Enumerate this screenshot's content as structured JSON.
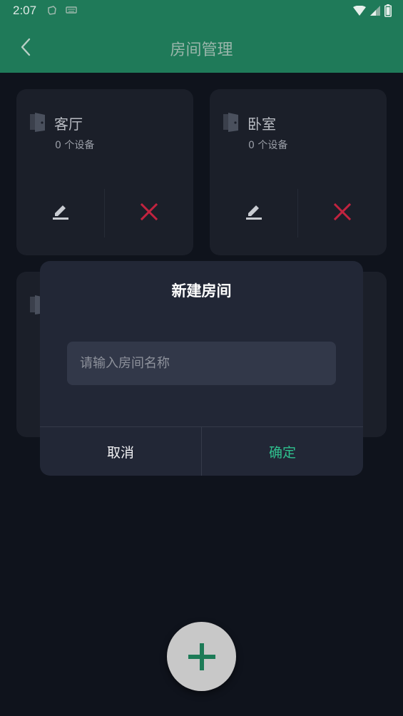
{
  "status_bar": {
    "time": "2:07"
  },
  "app_bar": {
    "title": "房间管理"
  },
  "rooms": [
    {
      "name": "客厅",
      "device_count": "0 个设备"
    },
    {
      "name": "卧室",
      "device_count": "0 个设备"
    }
  ],
  "dialog": {
    "title": "新建房间",
    "input_placeholder": "请输入房间名称",
    "input_value": "",
    "cancel_label": "取消",
    "confirm_label": "确定"
  },
  "colors": {
    "app_bar": "#1f7a59",
    "background": "#0f131c",
    "card": "#1b1f29",
    "dialog": "#222736",
    "accent": "#2fc08e",
    "delete": "#c2233f",
    "fab": "#c8c8c8",
    "fab_icon": "#1d7b57"
  },
  "icons": {
    "back": "chevron-left-icon",
    "door": "door-icon",
    "edit": "pencil-icon",
    "delete": "close-icon",
    "add": "plus-icon"
  }
}
